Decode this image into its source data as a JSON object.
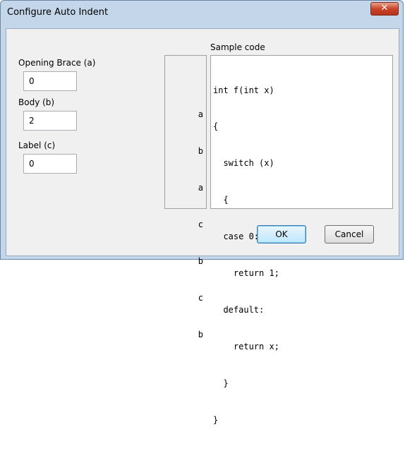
{
  "window": {
    "title": "Configure Auto Indent",
    "close_glyph": "✕"
  },
  "fields": [
    {
      "label": "Opening Brace (a)",
      "value": "0"
    },
    {
      "label": "Body (b)",
      "value": "2"
    },
    {
      "label": "Label (c)",
      "value": "0"
    }
  ],
  "sample": {
    "label": "Sample code",
    "gutter": [
      "",
      "a",
      "b",
      "a",
      "c",
      "b",
      "c",
      "b",
      "",
      ""
    ],
    "code": [
      "int f(int x)",
      "{",
      "  switch (x)",
      "  {",
      "  case 0:",
      "    return 1;",
      "  default:",
      "    return x;",
      "  }",
      "}"
    ]
  },
  "buttons": {
    "ok": "OK",
    "cancel": "Cancel"
  },
  "colors": {
    "frame": "#c3d6ea",
    "close_button": "#c9452a",
    "default_button_border": "#3c7fb1"
  },
  "icons": {
    "close": "close-icon"
  }
}
